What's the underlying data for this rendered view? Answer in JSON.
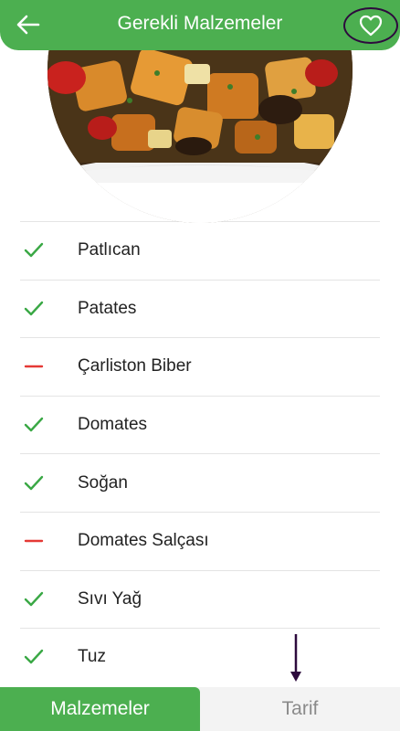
{
  "header": {
    "title": "Gerekli Malzemeler",
    "back_icon": "arrow-left-icon",
    "favorite_icon": "heart-outline-icon"
  },
  "image": {
    "description_icon": "dish-photo"
  },
  "ingredients": [
    {
      "name": "Patlıcan",
      "status": "available"
    },
    {
      "name": "Patates",
      "status": "available"
    },
    {
      "name": "Çarliston Biber",
      "status": "missing"
    },
    {
      "name": "Domates",
      "status": "available"
    },
    {
      "name": "Soğan",
      "status": "available"
    },
    {
      "name": "Domates Salçası",
      "status": "missing"
    },
    {
      "name": "Sıvı Yağ",
      "status": "available"
    },
    {
      "name": "Tuz",
      "status": "available"
    }
  ],
  "tabs": {
    "ingredients_label": "Malzemeler",
    "recipe_label": "Tarif"
  },
  "colors": {
    "primary": "#4caf50",
    "check": "#3aa845",
    "missing": "#e53935",
    "annotation": "#2d0a3d"
  }
}
